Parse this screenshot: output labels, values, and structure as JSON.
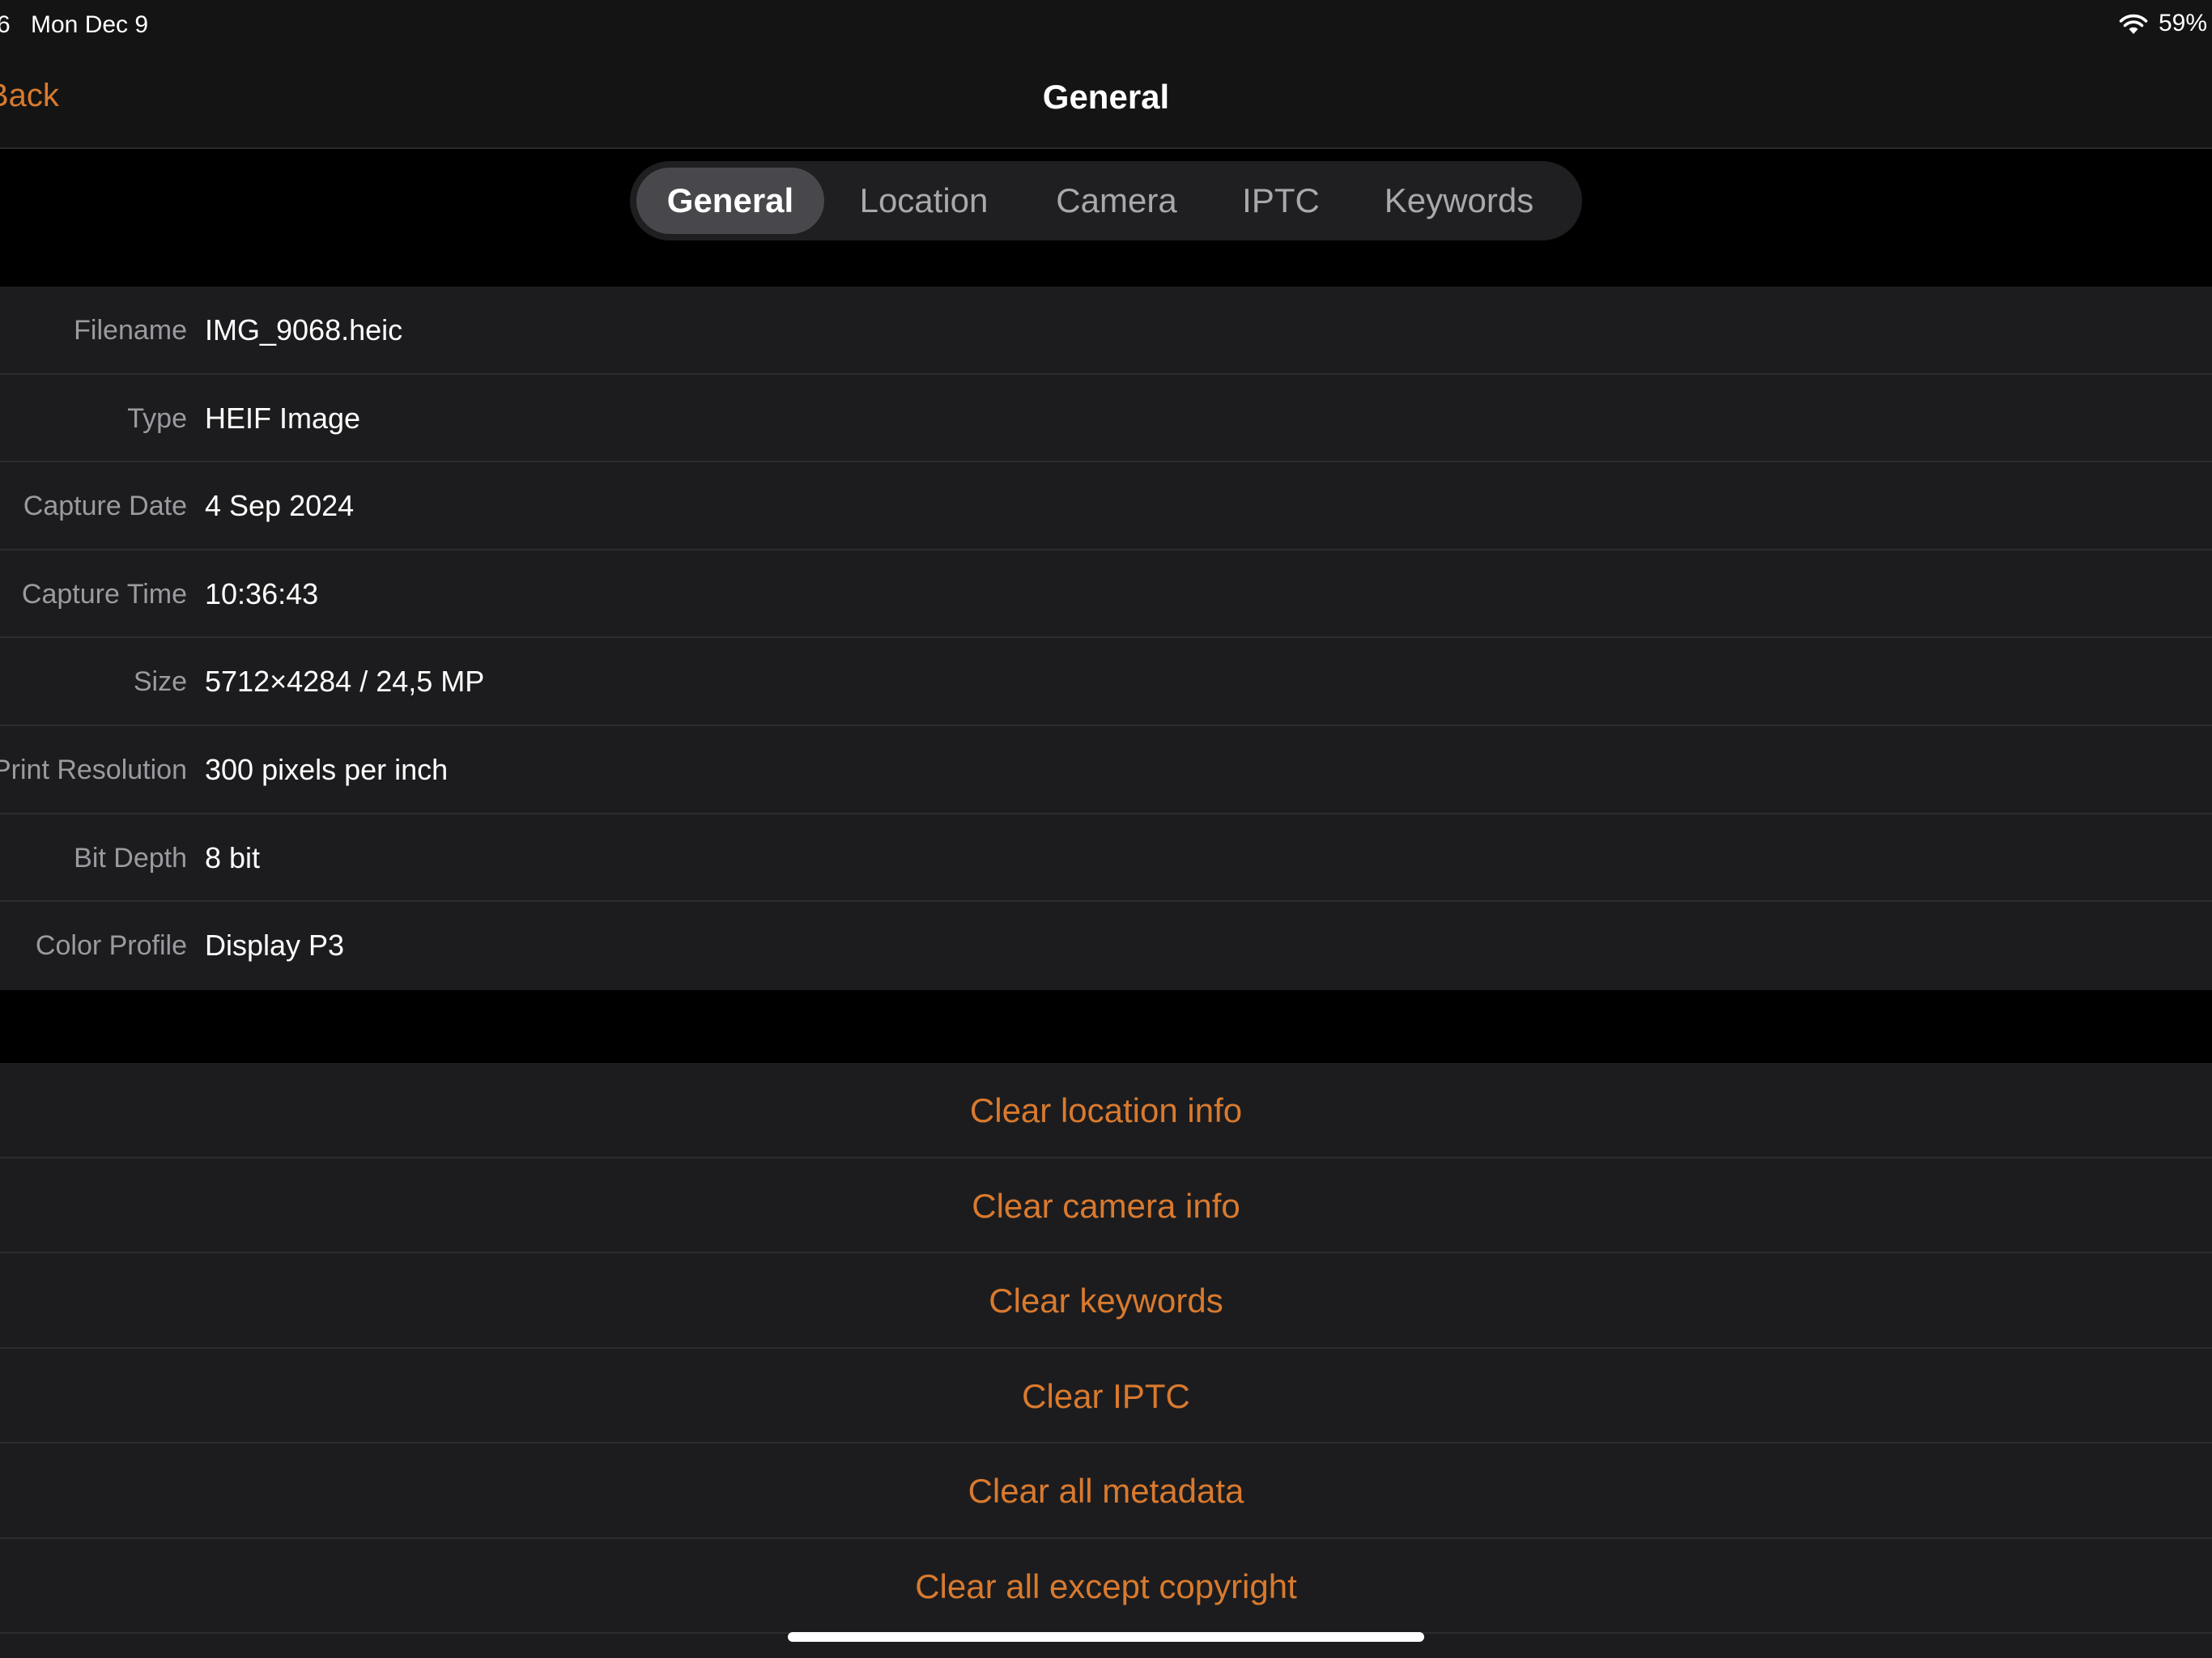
{
  "status_bar": {
    "time": "6",
    "date": "Mon Dec 9",
    "battery": "59%"
  },
  "nav": {
    "back_label": "Back",
    "title": "General"
  },
  "tabs": [
    {
      "label": "General",
      "active": true
    },
    {
      "label": "Location",
      "active": false
    },
    {
      "label": "Camera",
      "active": false
    },
    {
      "label": "IPTC",
      "active": false
    },
    {
      "label": "Keywords",
      "active": false
    }
  ],
  "info": [
    {
      "label": "Filename",
      "value": "IMG_9068.heic"
    },
    {
      "label": "Type",
      "value": "HEIF Image"
    },
    {
      "label": "Capture Date",
      "value": "4 Sep 2024"
    },
    {
      "label": "Capture Time",
      "value": "10:36:43"
    },
    {
      "label": "Size",
      "value": "5712×4284 / 24,5 MP"
    },
    {
      "label": "Print Resolution",
      "value": "300 pixels per inch"
    },
    {
      "label": "Bit Depth",
      "value": "8 bit"
    },
    {
      "label": "Color Profile",
      "value": "Display P3"
    }
  ],
  "actions": [
    "Clear location info",
    "Clear camera info",
    "Clear keywords",
    "Clear IPTC",
    "Clear all metadata",
    "Clear all except copyright"
  ],
  "colors": {
    "accent": "#d97a2e",
    "background": "#000000",
    "cell": "#1c1c1e",
    "bar": "#141414"
  },
  "icons": {
    "wifi": "wifi-icon"
  }
}
